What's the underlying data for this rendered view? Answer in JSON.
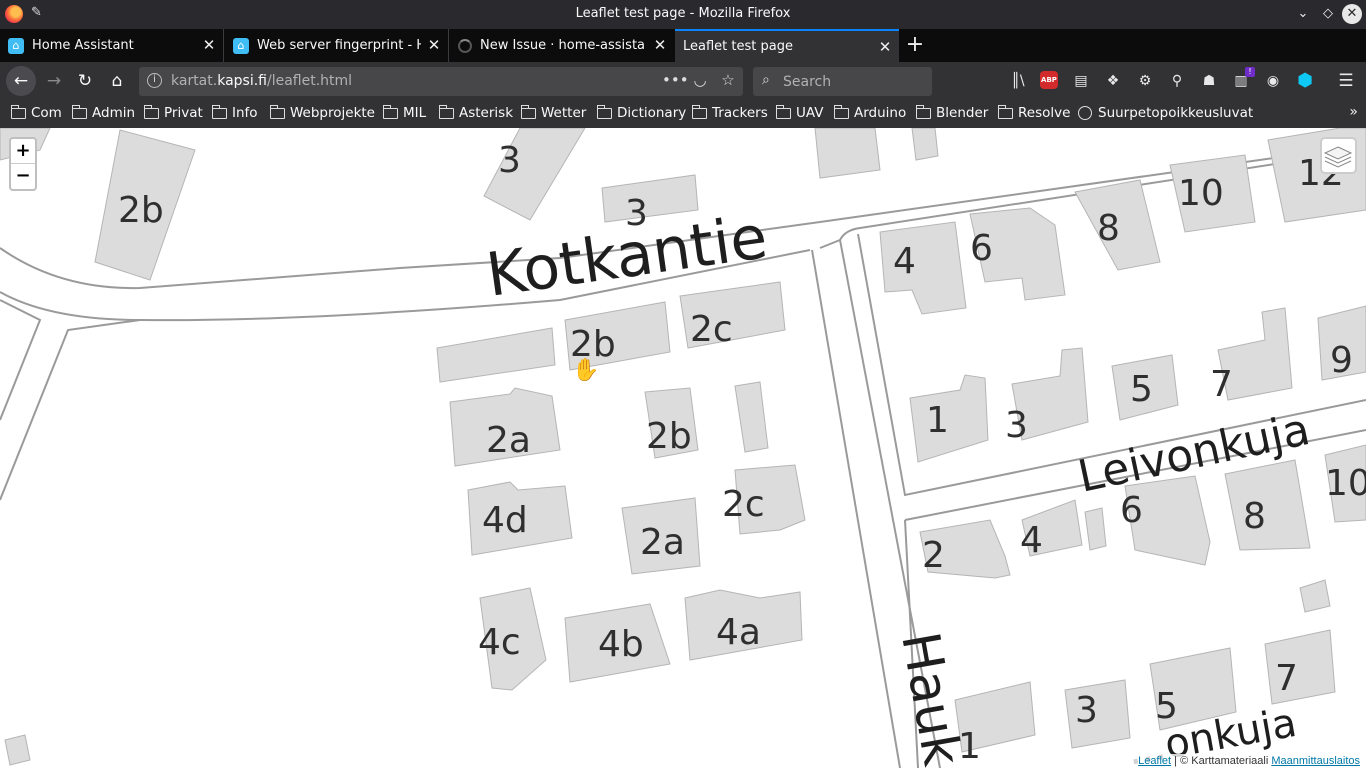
{
  "window": {
    "title": "Leaflet test page - Mozilla Firefox"
  },
  "tabs": [
    {
      "label": "Home Assistant",
      "icon": "home-assistant-icon"
    },
    {
      "label": "Web server fingerprint - H",
      "icon": "home-assistant-icon"
    },
    {
      "label": "New Issue · home-assistant",
      "icon": "github-loading-icon"
    },
    {
      "label": "Leaflet test page",
      "icon": "none",
      "active": true
    }
  ],
  "urlbar": {
    "prefix": "kartat.",
    "domain": "kapsi.fi",
    "path": "/leaflet.html"
  },
  "search": {
    "placeholder": "Search"
  },
  "bookmarks": [
    "Com",
    "Admin",
    "Privat",
    "Info",
    "Webprojekte",
    "MIL",
    "Asterisk",
    "Wetter",
    "Dictionary",
    "Trackers",
    "UAV",
    "Arduino",
    "Blender",
    "Resolve",
    "Suurpetopoikkeusluvat"
  ],
  "map": {
    "zoom_in": "+",
    "zoom_out": "−",
    "streets": {
      "kotkantie": "Kotkantie",
      "leivonkuja": "Leivonkuja",
      "hauk": "Hauk",
      "bottom_partial": "...onkuja"
    },
    "labels": [
      "3",
      "2b",
      "3",
      "4",
      "6",
      "8",
      "10",
      "12",
      "2b",
      "2c",
      "2a",
      "2b",
      "2c",
      "4d",
      "2a",
      "4c",
      "4b",
      "4a",
      "1",
      "3",
      "5",
      "7",
      "9",
      "2",
      "4",
      "6",
      "8",
      "10",
      "3",
      "5",
      "7",
      "1"
    ],
    "attribution": {
      "leaflet": "Leaflet",
      "separator": " | © Karttamateriaali ",
      "provider": "Maanmittauslaitos"
    }
  }
}
